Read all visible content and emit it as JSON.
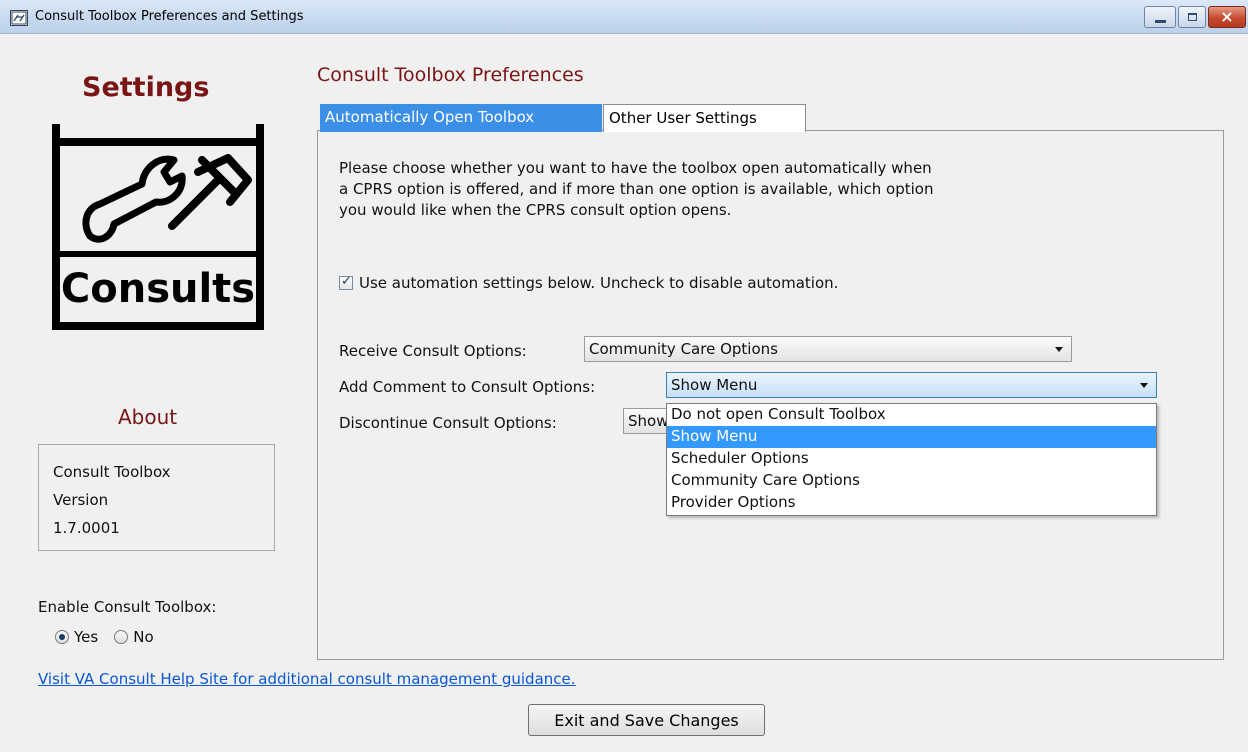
{
  "window": {
    "title": "Consult Toolbox Preferences and Settings",
    "minimize_icon": "minimize-icon",
    "maximize_icon": "maximize-icon",
    "close_glyph": "×"
  },
  "left": {
    "settings_title": "Settings",
    "logo": {
      "label": "Consults",
      "icon": "wrench-and-hammer-toolbox-logo"
    },
    "about_title": "About",
    "about_lines": [
      "Consult Toolbox",
      "Version",
      "1.7.0001"
    ],
    "enable_label": "Enable Consult Toolbox:",
    "enable_options": [
      {
        "label": "Yes",
        "selected": true
      },
      {
        "label": "No",
        "selected": false
      }
    ]
  },
  "main": {
    "title": "Consult Toolbox Preferences",
    "tabs": [
      {
        "label": "Automatically Open Toolbox",
        "active": true
      },
      {
        "label": "Other User Settings",
        "active": false
      }
    ],
    "instructions": [
      "Please choose whether you want to have the toolbox open automatically when",
      "a CPRS option is offered, and if more than one option is available, which option",
      "you would like when the CPRS consult option opens."
    ],
    "automation_checkbox": {
      "checked": true,
      "label": "Use automation settings below. Uncheck to disable automation."
    },
    "rows": [
      {
        "label": "Receive Consult Options:",
        "value": "Community Care Options"
      },
      {
        "label": "Add Comment to Consult Options:",
        "value": "Show Menu"
      },
      {
        "label": "Discontinue Consult Options:",
        "value": "Show Menu"
      }
    ],
    "dropdown_open": {
      "options": [
        "Do not open Consult Toolbox",
        "Show Menu",
        "Scheduler Options",
        "Community Care Options",
        "Provider Options"
      ],
      "selected_index": 1
    }
  },
  "footer": {
    "help_link": "Visit VA Consult Help Site for additional consult management guidance.",
    "exit_button": "Exit and Save Changes"
  },
  "colors": {
    "accent_maroon": "#7a1515",
    "tab_active": "#3b8fe6",
    "selection": "#3399ff",
    "link": "#0b57d0"
  }
}
